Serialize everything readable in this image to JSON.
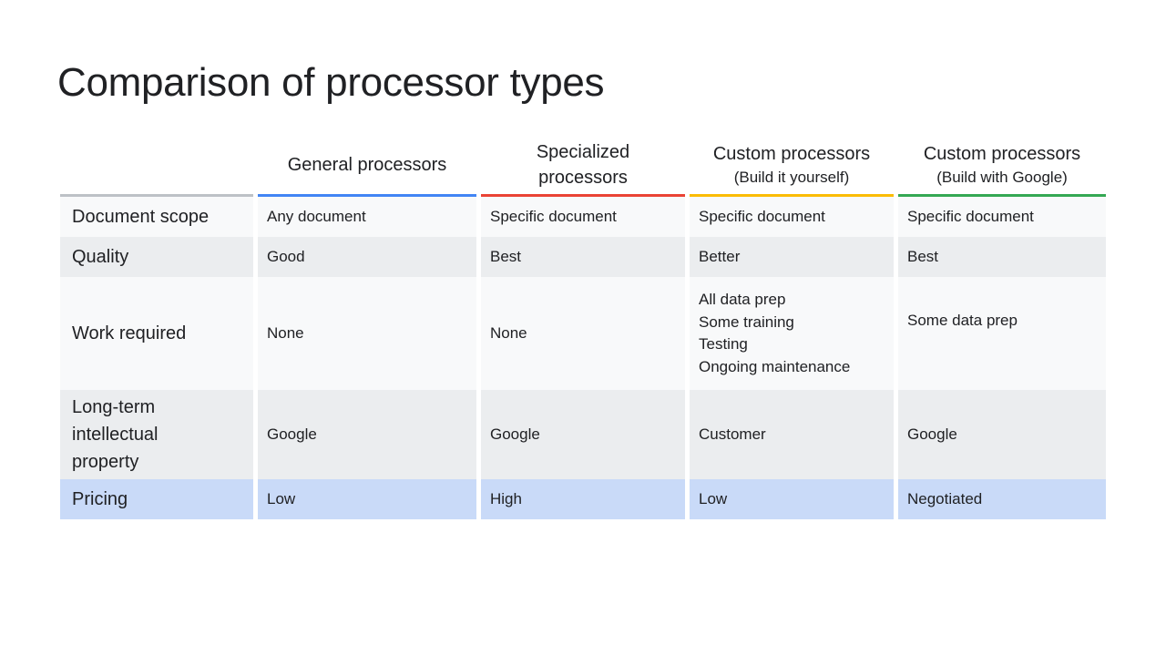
{
  "slide": {
    "title": "Comparison of processor types"
  },
  "table": {
    "columns": [
      {
        "line1": "General processors",
        "line2": ""
      },
      {
        "line1": "Specialized",
        "line2": "processors"
      },
      {
        "line1": "Custom processors",
        "line2": "(Build it yourself)"
      },
      {
        "line1": "Custom processors",
        "line2": "(Build with Google)"
      }
    ],
    "column_colors": [
      "#bdc1c6",
      "#4285f4",
      "#ea4335",
      "#fbbc04",
      "#34a853"
    ],
    "rows": [
      {
        "label": "Document scope",
        "cells": [
          "Any document",
          "Specific document",
          "Specific document",
          "Specific document"
        ]
      },
      {
        "label": "Quality",
        "cells": [
          "Good",
          "Best",
          "Better",
          "Best"
        ]
      },
      {
        "label": "Work required",
        "cells": [
          "None",
          "None",
          [
            "All data prep",
            "Some training",
            "Testing",
            "Ongoing maintenance"
          ],
          "Some data prep"
        ]
      },
      {
        "label": [
          "Long-term",
          "intellectual",
          "property"
        ],
        "cells": [
          "Google",
          "Google",
          "Customer",
          "Google"
        ]
      },
      {
        "label": "Pricing",
        "cells": [
          "Low",
          "High",
          "Low",
          "Negotiated"
        ]
      }
    ],
    "row_highlight_color": "#c9daf8"
  }
}
